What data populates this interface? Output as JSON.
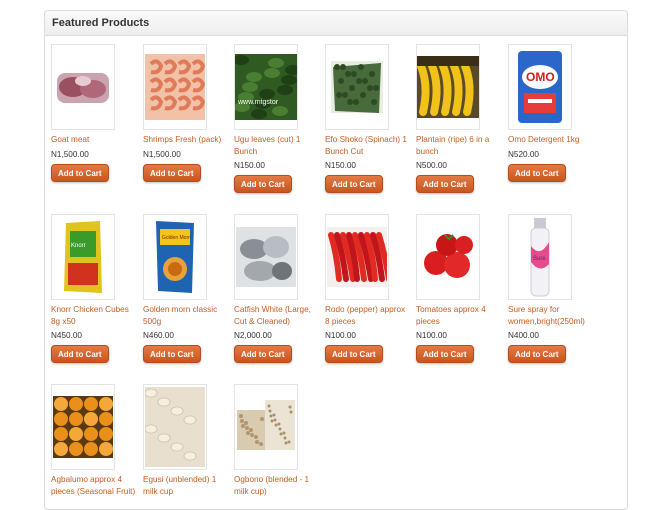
{
  "panel": {
    "title": "Featured Products"
  },
  "products": [
    {
      "name": "Goat meat",
      "price": "N1,500.00",
      "button": "Add to Cart",
      "icon": "goat-meat-image"
    },
    {
      "name": "Shrimps Fresh (pack)",
      "price": "N1,500.00",
      "button": "Add to Cart",
      "icon": "shrimps-image"
    },
    {
      "name": "Ugu leaves (cut) 1 Bunch",
      "price": "N150.00",
      "button": "Add to Cart",
      "icon": "ugu-leaves-image",
      "watermark": "www.mtgstor"
    },
    {
      "name": "Efo Shoko (Spinach) 1 Bunch Cut",
      "price": "N150.00",
      "button": "Add to Cart",
      "icon": "spinach-image"
    },
    {
      "name": "Plantain (ripe) 6 in a bunch",
      "price": "N500.00",
      "button": "Add to Cart",
      "icon": "plantain-image"
    },
    {
      "name": "Omo Detergent 1kg",
      "price": "N520.00",
      "button": "Add to Cart",
      "icon": "detergent-image",
      "brand": "OMO"
    },
    {
      "name": "Knorr Chicken Cubes 8g x50",
      "price": "N450.00",
      "button": "Add to Cart",
      "icon": "knorr-cubes-image"
    },
    {
      "name": "Golden morn classic 500g",
      "price": "N460.00",
      "button": "Add to Cart",
      "icon": "golden-morn-image",
      "brand": "Golden Morn"
    },
    {
      "name": "Catfish White (Large, Cut & Cleaned)",
      "price": "N2,000.00",
      "button": "Add to Cart",
      "icon": "catfish-image"
    },
    {
      "name": "Rodo (pepper) approx 8 pieces",
      "price": "N100.00",
      "button": "Add to Cart",
      "icon": "pepper-image"
    },
    {
      "name": "Tomatoes approx 4 pieces",
      "price": "N100.00",
      "button": "Add to Cart",
      "icon": "tomatoes-image"
    },
    {
      "name": "Sure spray for women,bright(250ml)",
      "price": "N400.00",
      "button": "Add to Cart",
      "icon": "sure-spray-image",
      "brand": "Sure"
    },
    {
      "name": "Agbalumo approx 4 pieces (Seasonal Fruit)",
      "price": "",
      "button": "",
      "icon": "agbalumo-image"
    },
    {
      "name": "Egusi (unblended) 1 milk cup",
      "price": "",
      "button": "",
      "icon": "egusi-image"
    },
    {
      "name": "Ogbono (blended - 1 milk cup)",
      "price": "",
      "button": "",
      "icon": "ogbono-image"
    }
  ],
  "colors": {
    "link": "#c45d24",
    "button": "#d4622c"
  }
}
